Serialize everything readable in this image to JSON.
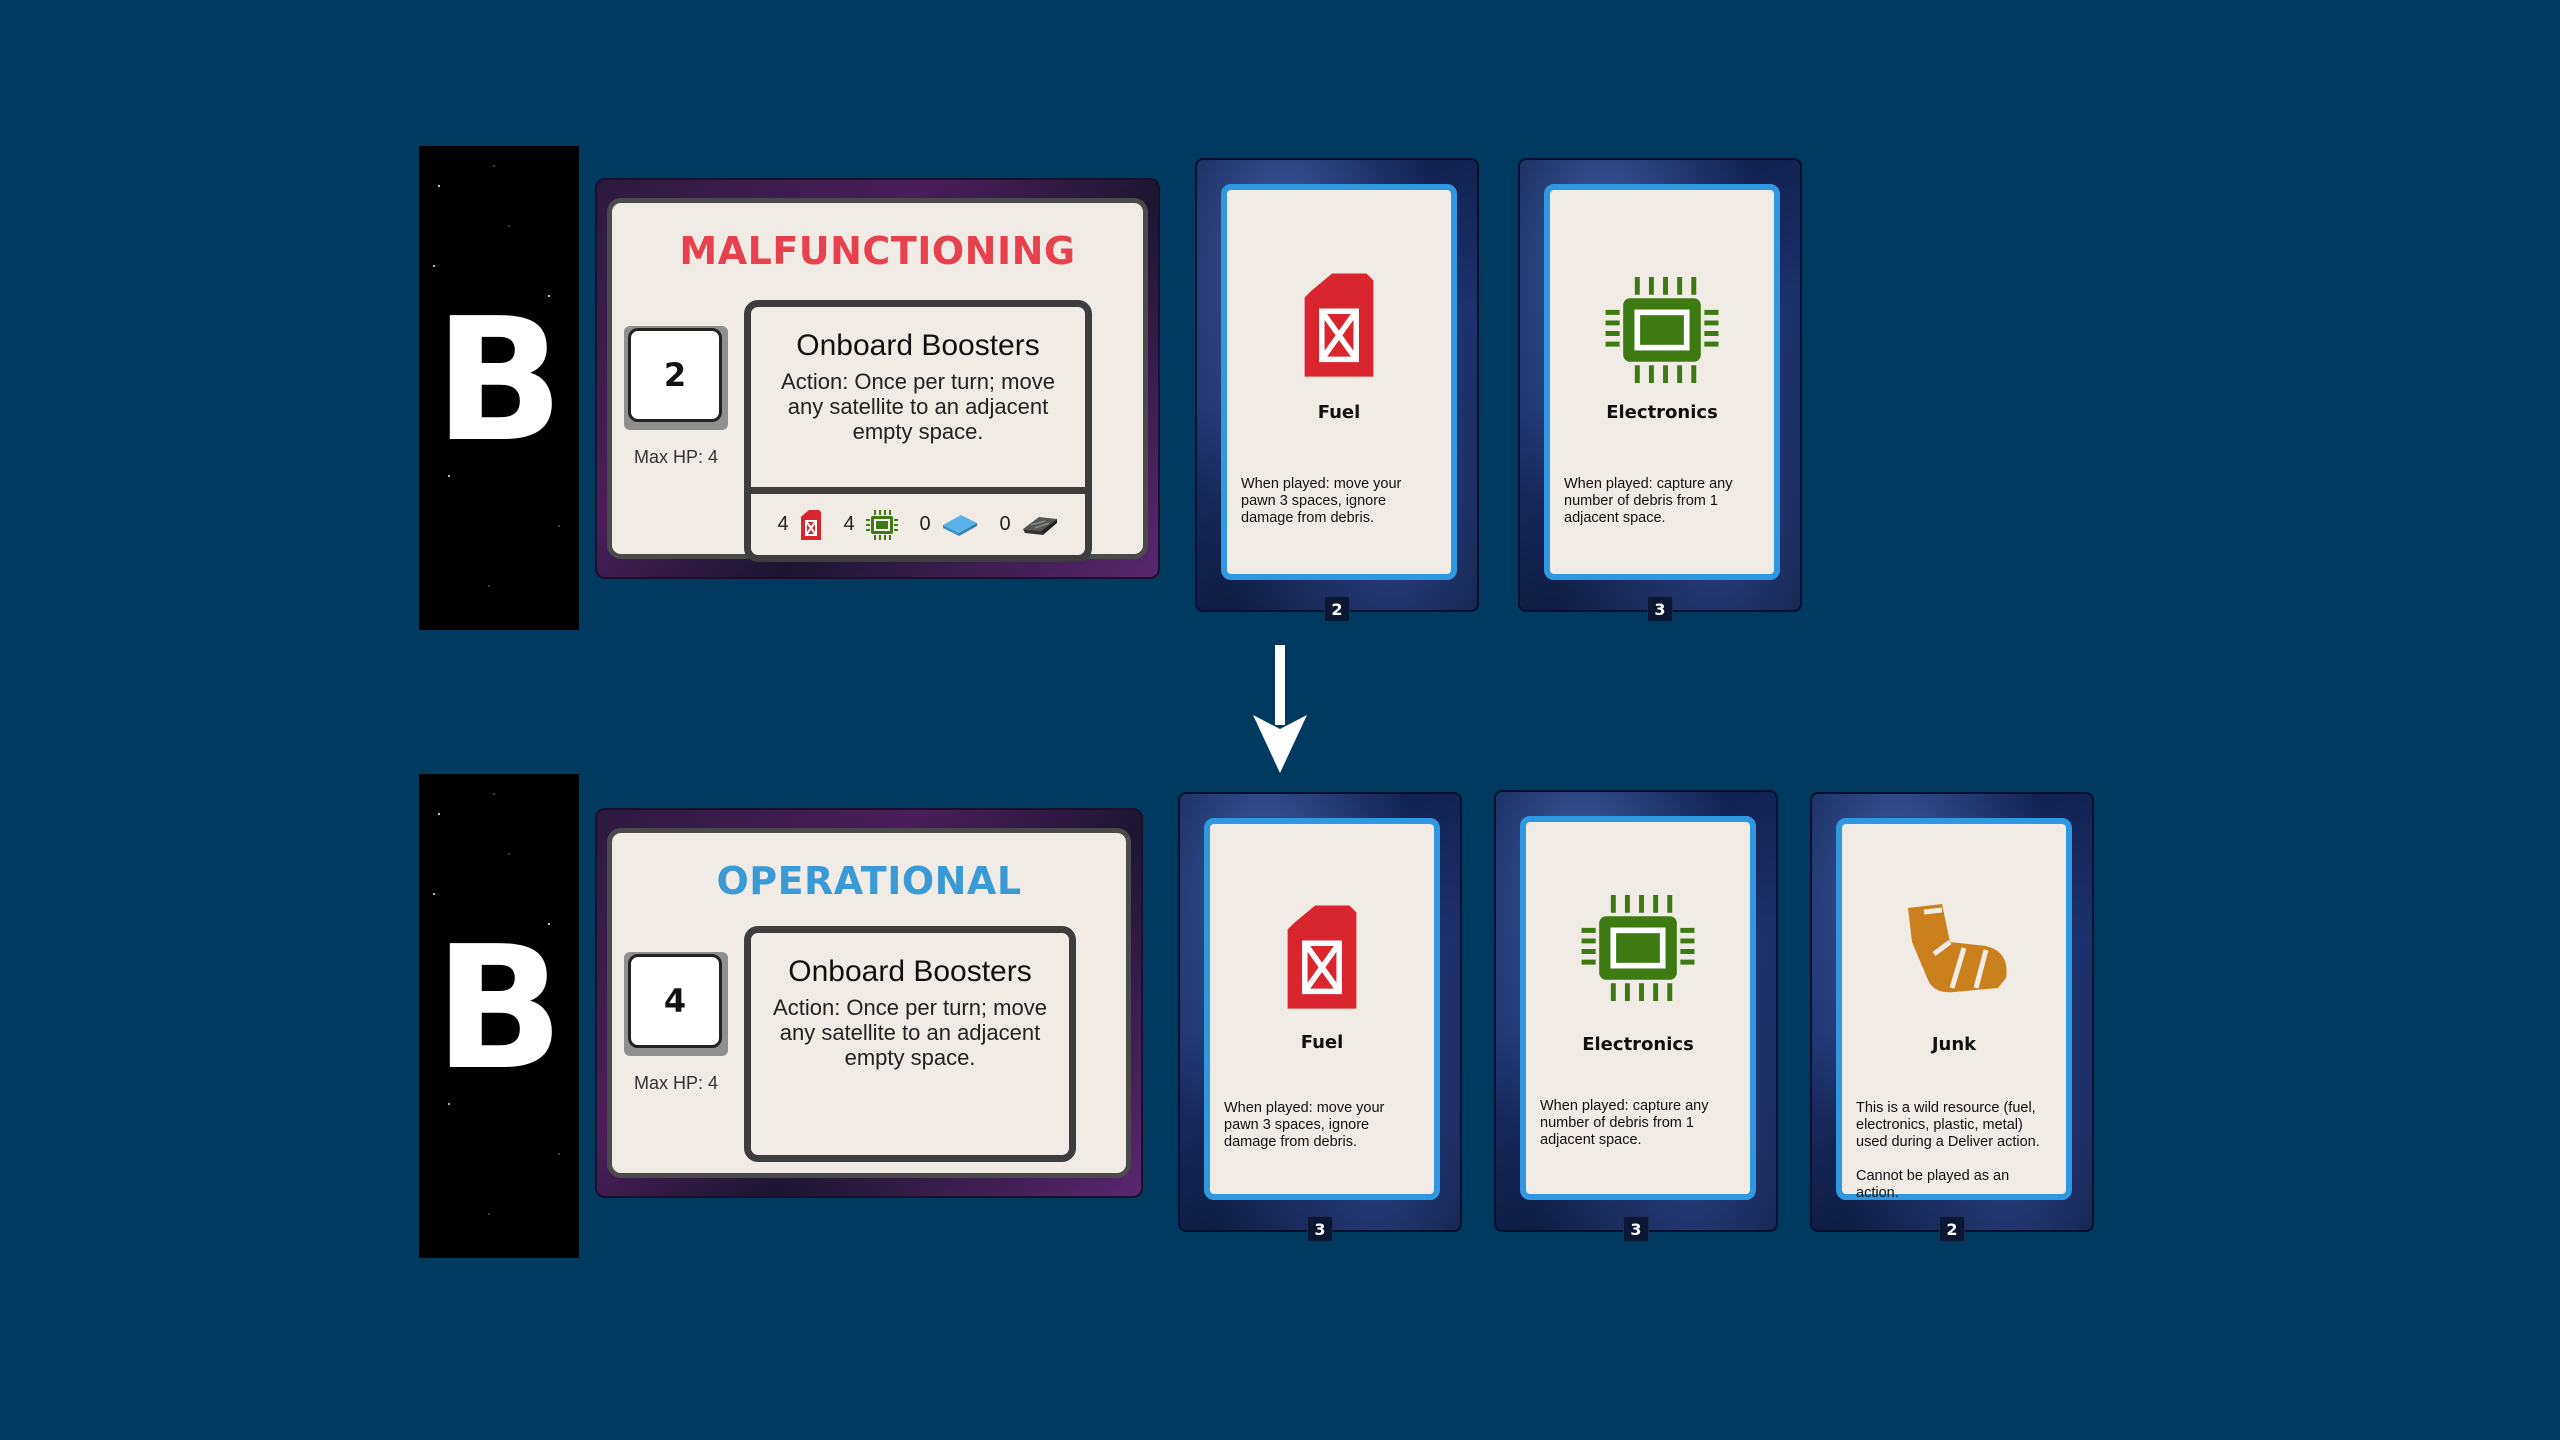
{
  "before": {
    "sector_letter": "B",
    "satellite": {
      "status": "MALFUNCTIONING",
      "hp": "2",
      "max_hp": "Max HP: 4",
      "ability_name": "Onboard Boosters",
      "ability_text": "Action: Once per turn; move any satellite to an adjacent empty space.",
      "resources": [
        {
          "icon": "fuel-icon",
          "count": "4"
        },
        {
          "icon": "electronics-icon",
          "count": "4"
        },
        {
          "icon": "plastic-icon",
          "count": "0"
        },
        {
          "icon": "metal-icon",
          "count": "0"
        }
      ]
    },
    "cards": [
      {
        "name": "Fuel",
        "icon": "fuel-icon",
        "desc": "When played: move your pawn 3 spaces, ignore damage from debris.",
        "count": "2"
      },
      {
        "name": "Electronics",
        "icon": "electronics-icon",
        "desc": "When played: capture any number of debris from 1 adjacent space.",
        "count": "3"
      }
    ]
  },
  "after": {
    "sector_letter": "B",
    "satellite": {
      "status": "OPERATIONAL",
      "hp": "4",
      "max_hp": "Max HP: 4",
      "ability_name": "Onboard Boosters",
      "ability_text": "Action: Once per turn; move any satellite to an adjacent empty space."
    },
    "cards": [
      {
        "name": "Fuel",
        "icon": "fuel-icon",
        "desc": "When played: move your pawn 3 spaces, ignore damage from debris.",
        "count": "3"
      },
      {
        "name": "Electronics",
        "icon": "electronics-icon",
        "desc": "When played: capture any number of debris from 1 adjacent space.",
        "count": "3"
      },
      {
        "name": "Junk",
        "icon": "junk-boot-icon",
        "desc": "This is a wild resource (fuel, electronics, plastic, metal) used during a Deliver action.\n\nCannot be played as an action.",
        "count": "2"
      }
    ]
  },
  "colors": {
    "background": "#003a61",
    "malfunctioning": "#e8414e",
    "operational": "#3a9ad6",
    "card_border": "#2f98e0",
    "fuel": "#d9262e",
    "electronics": "#3d7a12",
    "junk": "#c9801d"
  },
  "transition_icon": "down-arrow-icon"
}
